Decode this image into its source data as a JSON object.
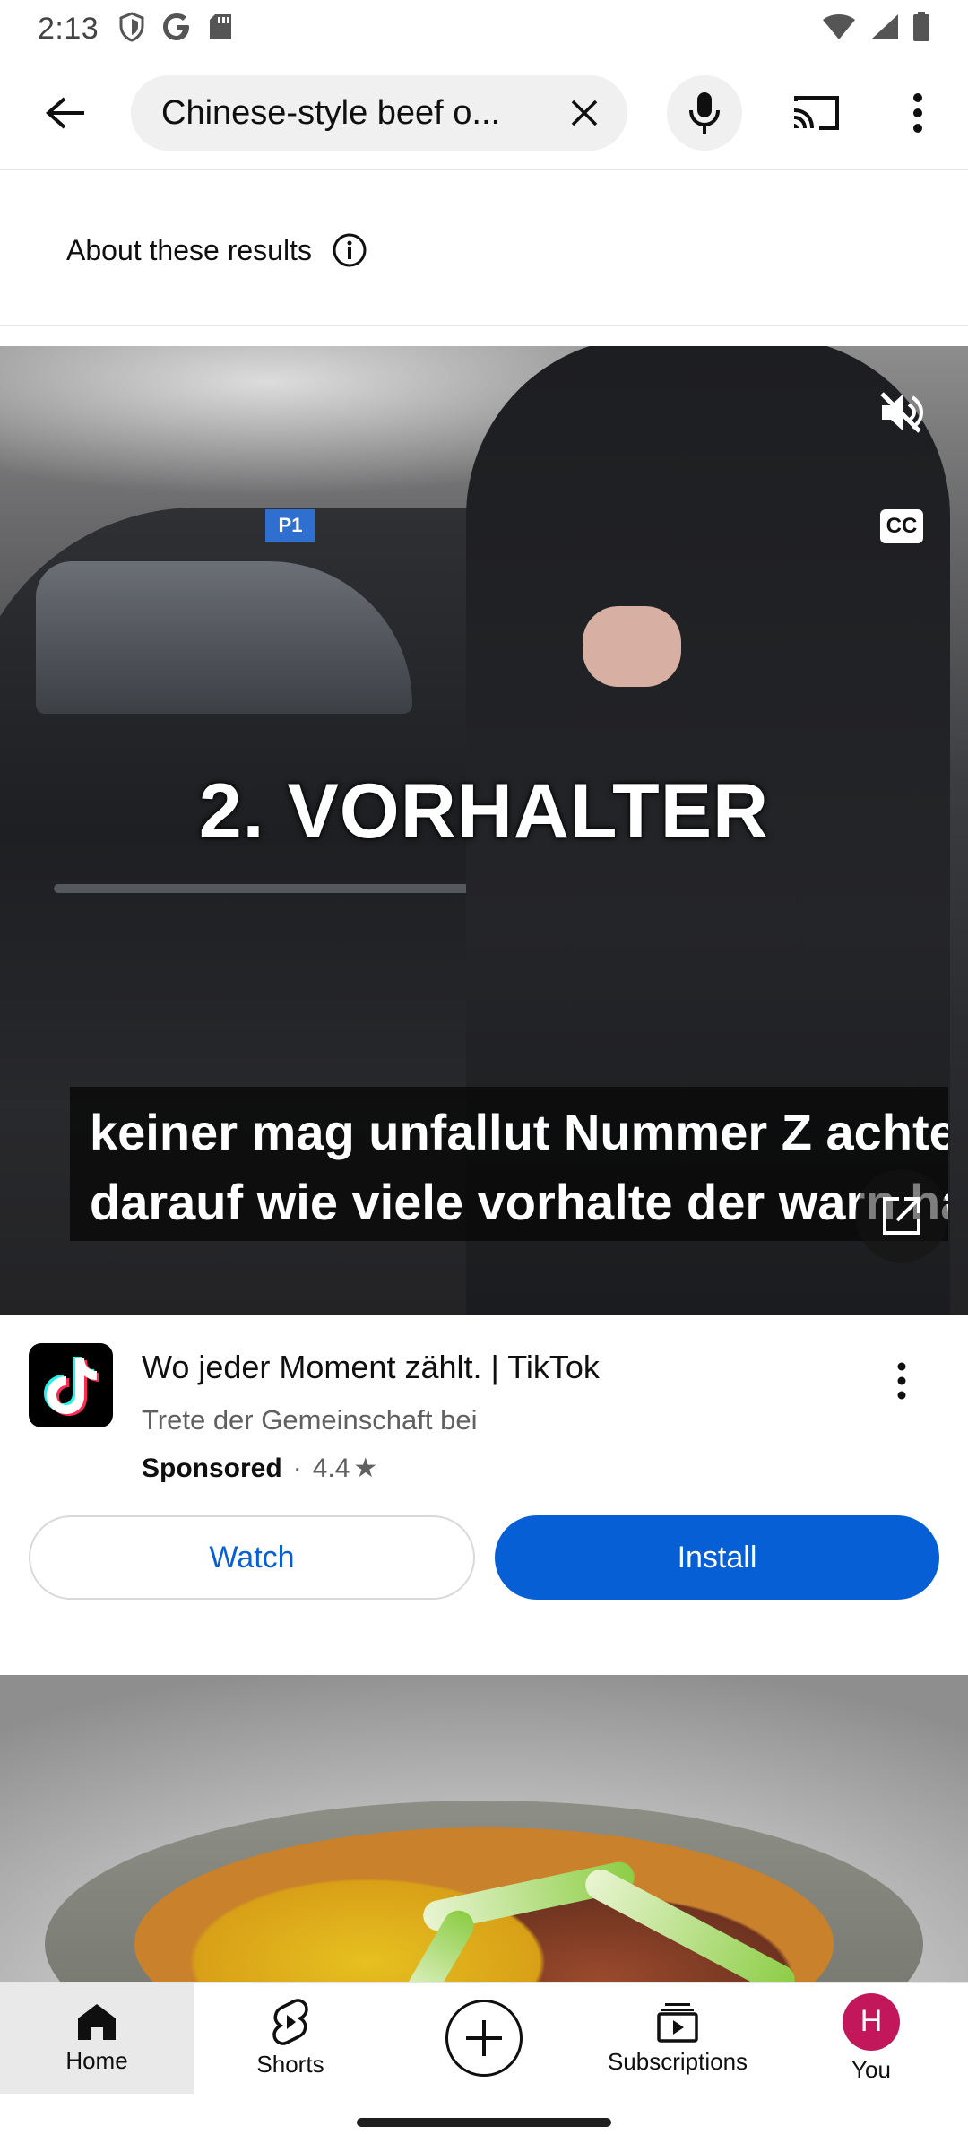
{
  "status_bar": {
    "time": "2:13",
    "left_icons": [
      "shield-icon",
      "google-icon",
      "sd-card-icon"
    ],
    "right_icons": [
      "wifi-icon",
      "cell-signal-icon",
      "battery-icon"
    ]
  },
  "search": {
    "query": "Chinese-style beef o...",
    "icons": {
      "back": "arrow-left-icon",
      "clear": "close-icon",
      "mic": "microphone-icon",
      "cast": "cast-icon",
      "more": "more-vert-icon"
    }
  },
  "about": {
    "label": "About these results",
    "icon": "info-icon"
  },
  "video": {
    "overlay_title": "2. VORHALTER",
    "captions": [
      "keiner mag unfallut Nummer Z achte",
      "darauf wie viele vorhalte der warn hat"
    ],
    "cc_label": "CC",
    "parking_sign": "P1",
    "muted": true
  },
  "ad": {
    "title": "Wo jeder Moment zählt. | TikTok",
    "description": "Trete der Gemeinschaft bei",
    "sponsored_label": "Sponsored",
    "separator": "·",
    "rating": "4.4",
    "star": "★",
    "watch_label": "Watch",
    "install_label": "Install"
  },
  "bottom_nav": {
    "items": [
      {
        "label": "Home",
        "icon": "home-icon",
        "active": true
      },
      {
        "label": "Shorts",
        "icon": "shorts-icon",
        "active": false
      },
      {
        "label": "",
        "icon": "create-plus-icon",
        "active": false
      },
      {
        "label": "Subscriptions",
        "icon": "subscriptions-icon",
        "active": false
      },
      {
        "label": "You",
        "icon": "avatar",
        "active": false
      }
    ],
    "avatar_letter": "H"
  },
  "colors": {
    "accent_blue": "#065fd4",
    "avatar_bg": "#c2185b",
    "active_nav_bg": "#e9e9e9"
  }
}
